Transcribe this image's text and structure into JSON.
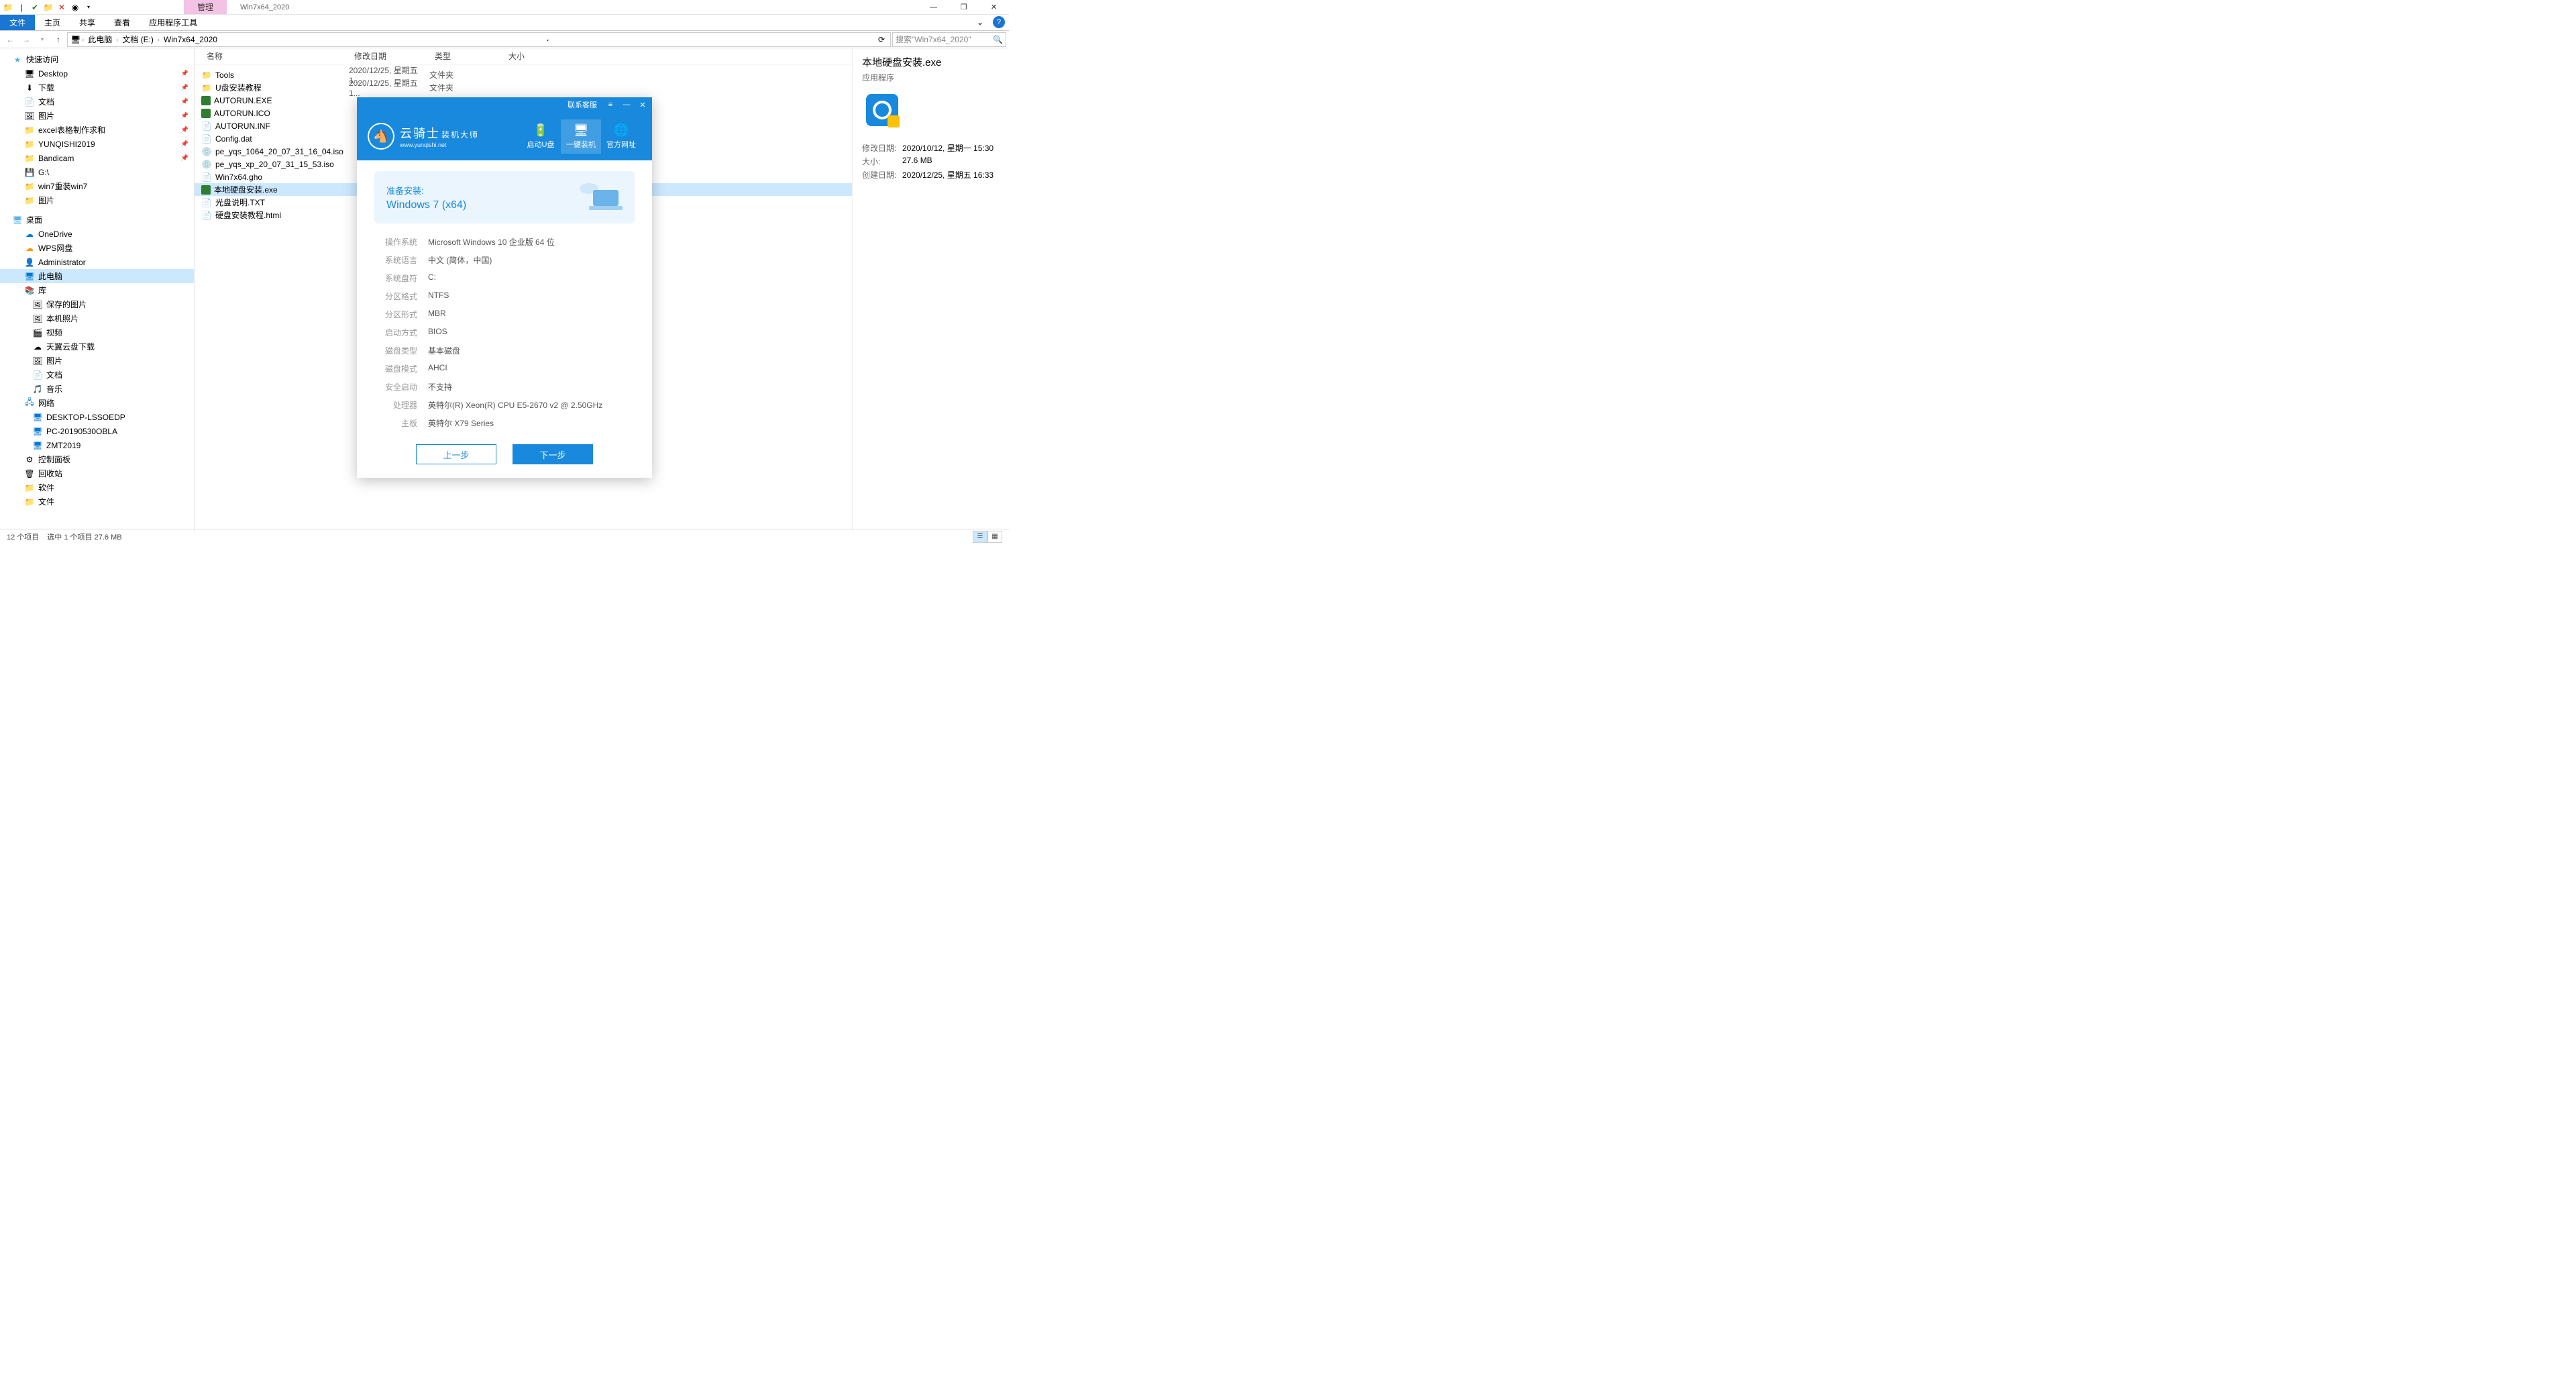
{
  "window": {
    "context_tab": "管理",
    "title": "Win7x64_2020",
    "minimize": "—",
    "maximize": "❐",
    "close": "✕"
  },
  "ribbon": {
    "file": "文件",
    "tabs": [
      "主页",
      "共享",
      "查看",
      "应用程序工具"
    ]
  },
  "address": {
    "back": "←",
    "forward": "→",
    "up": "↑",
    "crumbs": [
      "此电脑",
      "文档 (E:)",
      "Win7x64_2020"
    ],
    "search_placeholder": "搜索\"Win7x64_2020\""
  },
  "nav": {
    "quick_access": "快速访问",
    "quick_items": [
      {
        "icon": "🖥",
        "label": "Desktop",
        "pin": true
      },
      {
        "icon": "⬇",
        "label": "下载",
        "pin": true
      },
      {
        "icon": "📄",
        "label": "文档",
        "pin": true
      },
      {
        "icon": "🖼",
        "label": "图片",
        "pin": true
      },
      {
        "icon": "📁",
        "label": "excel表格制作求和",
        "pin": true
      },
      {
        "icon": "📁",
        "label": "YUNQISHI2019",
        "pin": true
      },
      {
        "icon": "📁",
        "label": "Bandicam",
        "pin": true
      },
      {
        "icon": "💾",
        "label": "G:\\",
        "pin": false
      },
      {
        "icon": "📁",
        "label": "win7重装win7",
        "pin": false
      },
      {
        "icon": "📁",
        "label": "图片",
        "pin": false
      }
    ],
    "desktop": "桌面",
    "desktop_items": [
      {
        "icon": "☁",
        "label": "OneDrive",
        "color": "#0078d4"
      },
      {
        "icon": "☁",
        "label": "WPS网盘",
        "color": "#ff9800"
      },
      {
        "icon": "👤",
        "label": "Administrator",
        "color": "#ffc107"
      },
      {
        "icon": "🖥",
        "label": "此电脑",
        "selected": true,
        "color": "#0078d4"
      },
      {
        "icon": "📚",
        "label": "库",
        "color": "#ffc107"
      }
    ],
    "library_items": [
      {
        "icon": "🖼",
        "label": "保存的图片"
      },
      {
        "icon": "🖼",
        "label": "本机照片"
      },
      {
        "icon": "🎬",
        "label": "视频"
      },
      {
        "icon": "☁",
        "label": "天翼云盘下载"
      },
      {
        "icon": "🖼",
        "label": "图片"
      },
      {
        "icon": "📄",
        "label": "文档"
      },
      {
        "icon": "🎵",
        "label": "音乐"
      }
    ],
    "network": "网络",
    "network_items": [
      {
        "icon": "🖥",
        "label": "DESKTOP-LSSOEDP"
      },
      {
        "icon": "🖥",
        "label": "PC-20190530OBLA"
      },
      {
        "icon": "🖥",
        "label": "ZMT2019"
      }
    ],
    "bottom_items": [
      {
        "icon": "⚙",
        "label": "控制面板"
      },
      {
        "icon": "🗑",
        "label": "回收站"
      },
      {
        "icon": "📁",
        "label": "软件"
      },
      {
        "icon": "📁",
        "label": "文件"
      }
    ]
  },
  "columns": {
    "name": "名称",
    "date": "修改日期",
    "type": "类型",
    "size": "大小"
  },
  "files": [
    {
      "icon": "folder",
      "name": "Tools",
      "date": "2020/12/25, 星期五 1...",
      "type": "文件夹"
    },
    {
      "icon": "folder",
      "name": "U盘安装教程",
      "date": "2020/12/25, 星期五 1...",
      "type": "文件夹"
    },
    {
      "icon": "exe",
      "name": "AUTORUN.EXE",
      "date": "",
      "type": ""
    },
    {
      "icon": "ico",
      "name": "AUTORUN.ICO",
      "date": "",
      "type": ""
    },
    {
      "icon": "txt",
      "name": "AUTORUN.INF",
      "date": "",
      "type": ""
    },
    {
      "icon": "txt",
      "name": "Config.dat",
      "date": "",
      "type": ""
    },
    {
      "icon": "disc",
      "name": "pe_yqs_1064_20_07_31_16_04.iso",
      "date": "",
      "type": ""
    },
    {
      "icon": "disc",
      "name": "pe_yqs_xp_20_07_31_15_53.iso",
      "date": "",
      "type": ""
    },
    {
      "icon": "txt",
      "name": "Win7x64.gho",
      "date": "",
      "type": ""
    },
    {
      "icon": "exe",
      "name": "本地硬盘安装.exe",
      "date": "",
      "type": "",
      "selected": true
    },
    {
      "icon": "txt",
      "name": "光盘说明.TXT",
      "date": "",
      "type": ""
    },
    {
      "icon": "txt",
      "name": "硬盘安装教程.html",
      "date": "",
      "type": ""
    }
  ],
  "details": {
    "title": "本地硬盘安装.exe",
    "type": "应用程序",
    "rows": [
      {
        "label": "修改日期:",
        "value": "2020/10/12, 星期一 15:30"
      },
      {
        "label": "大小:",
        "value": "27.6 MB"
      },
      {
        "label": "创建日期:",
        "value": "2020/12/25, 星期五 16:33"
      }
    ]
  },
  "status": {
    "count": "12 个项目",
    "selection": "选中 1 个项目  27.6 MB"
  },
  "installer": {
    "titlebar": {
      "contact": "联系客服",
      "menu": "≡",
      "min": "—",
      "close": "✕"
    },
    "brand": {
      "name": "云骑士",
      "suffix": "装机大师",
      "url": "www.yunqishi.net"
    },
    "nav": [
      {
        "icon": "🔋",
        "label": "启动U盘"
      },
      {
        "icon": "🖥",
        "label": "一键装机",
        "active": true
      },
      {
        "icon": "🌐",
        "label": "官方网址"
      }
    ],
    "banner": {
      "line1": "准备安装:",
      "line2": "Windows 7 (x64)"
    },
    "info": [
      {
        "label": "操作系统",
        "value": "Microsoft Windows 10 企业版 64 位"
      },
      {
        "label": "系统语言",
        "value": "中文 (简体，中国)"
      },
      {
        "label": "系统盘符",
        "value": "C:"
      },
      {
        "label": "分区格式",
        "value": "NTFS"
      },
      {
        "label": "分区形式",
        "value": "MBR"
      },
      {
        "label": "启动方式",
        "value": "BIOS"
      },
      {
        "label": "磁盘类型",
        "value": "基本磁盘"
      },
      {
        "label": "磁盘模式",
        "value": "AHCI"
      },
      {
        "label": "安全启动",
        "value": "不支持"
      },
      {
        "label": "处理器",
        "value": "英特尔(R) Xeon(R) CPU E5-2670 v2 @ 2.50GHz"
      },
      {
        "label": "主板",
        "value": "英特尔 X79 Series"
      }
    ],
    "buttons": {
      "prev": "上一步",
      "next": "下一步"
    }
  }
}
